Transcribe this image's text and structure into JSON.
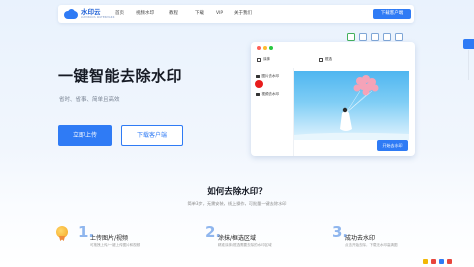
{
  "brand": {
    "name": "水印云",
    "tagline": "LUMINOUS WATERMARK"
  },
  "nav": {
    "items": [
      "首页",
      "视频水印",
      "教程",
      "下载",
      "VIP",
      "关于我们"
    ],
    "download_button": "下载客户端"
  },
  "hero": {
    "title": "一键智能去除水印",
    "subtitle": "省时、省事、简单且高效",
    "upload_button": "立即上传",
    "download_button": "下载客户端"
  },
  "preview": {
    "tools": [
      "涂抹",
      "框选"
    ],
    "side_items": [
      "图片去水印",
      "视频去水印"
    ],
    "start_button": "开始去水印",
    "window_dots": [
      "#ff5f57",
      "#febc2e",
      "#28c840"
    ]
  },
  "section": {
    "title": "如何去除水印？",
    "subtitle": "简单3步，无需安装，线上操作，可批量一键去除水印",
    "steps": [
      {
        "num": "1.",
        "label": "上传图片/视频",
        "desc": "可拖拽上传/一键上传图片和视频"
      },
      {
        "num": "2.",
        "label": "涂抹/框选区域",
        "desc": "精准涂抹/框选需要去除的水印区域"
      },
      {
        "num": "3.",
        "label": "成功去水印",
        "desc": "点击开始去除，下载无水印高清图"
      }
    ]
  },
  "colors": {
    "accent": "#2f7bf5",
    "background": "#eef4fd"
  }
}
